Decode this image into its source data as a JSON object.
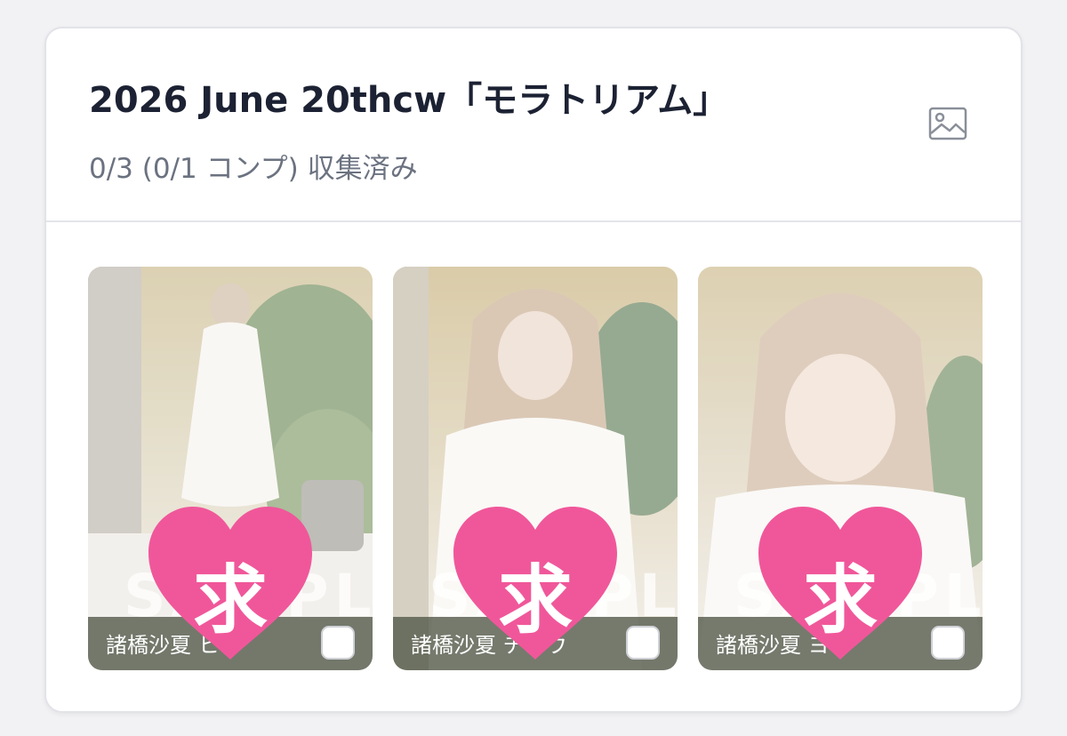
{
  "collection": {
    "title": "2026 June 20thcw「モラトリアム」",
    "progress": "0/3 (0/1 コンプ) 収集済み",
    "image_icon": "image-icon"
  },
  "cards": [
    {
      "name": "諸橋沙夏 ヒキ",
      "badge": "求",
      "watermark": "SAMPLE",
      "checked": false
    },
    {
      "name": "諸橋沙夏 チュウ",
      "badge": "求",
      "watermark": "SAMPLE",
      "checked": false
    },
    {
      "name": "諸橋沙夏 ヨリ",
      "badge": "求",
      "watermark": "SAMPLE",
      "checked": false
    }
  ],
  "colors": {
    "heart": "#f0579a",
    "title": "#1c2233",
    "subtitle": "#6b7280"
  }
}
